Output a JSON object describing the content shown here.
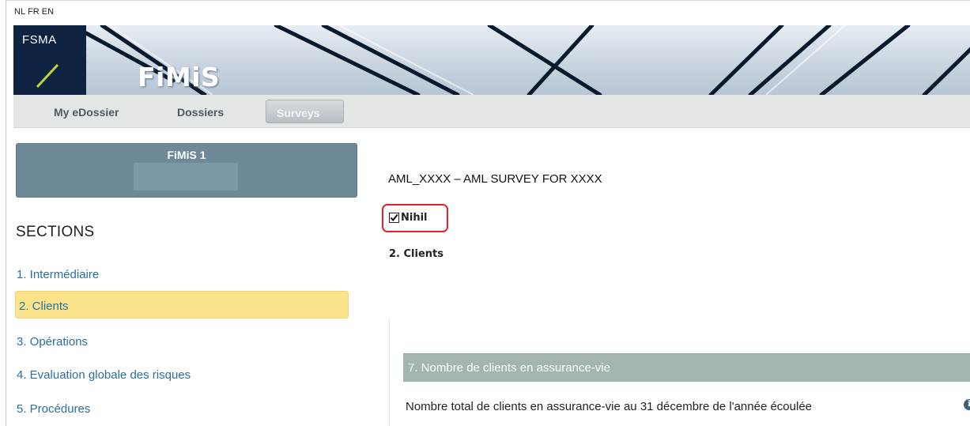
{
  "languages": [
    "NL",
    "FR",
    "EN"
  ],
  "brand": {
    "org": "FSMA",
    "app": "FiMiS"
  },
  "nav": {
    "tabs": [
      {
        "label": "My eDossier"
      },
      {
        "label": "Dossiers"
      },
      {
        "label": "Surveys"
      }
    ],
    "active_tab": "Surveys"
  },
  "sidebar": {
    "box_title": "FiMiS 1",
    "sections_heading": "SECTIONS",
    "items": [
      {
        "label": "1. Intermédiaire"
      },
      {
        "label": "2. Clients"
      },
      {
        "label": "3. Opérations"
      },
      {
        "label": "4. Evaluation globale des risques"
      },
      {
        "label": "5. Procédures"
      }
    ],
    "active_item": "2. Clients"
  },
  "main": {
    "survey_title": "AML_XXXX – AML SURVEY FOR XXXX",
    "nihil": {
      "label": "Nihil",
      "checked": true
    },
    "section_heading": "2. Clients",
    "question_block": {
      "header": "7. Nombre de clients en assurance-vie",
      "question": "Nombre total de clients en assurance-vie au 31 décembre de l'année écoulée",
      "info_icon": "info-icon"
    }
  },
  "colors": {
    "brand_navy": "#0e2341",
    "active_section": "#fbe38c",
    "question_header": "#a3b5b1",
    "link": "#2b6fa0",
    "highlight": "#e2232a"
  }
}
